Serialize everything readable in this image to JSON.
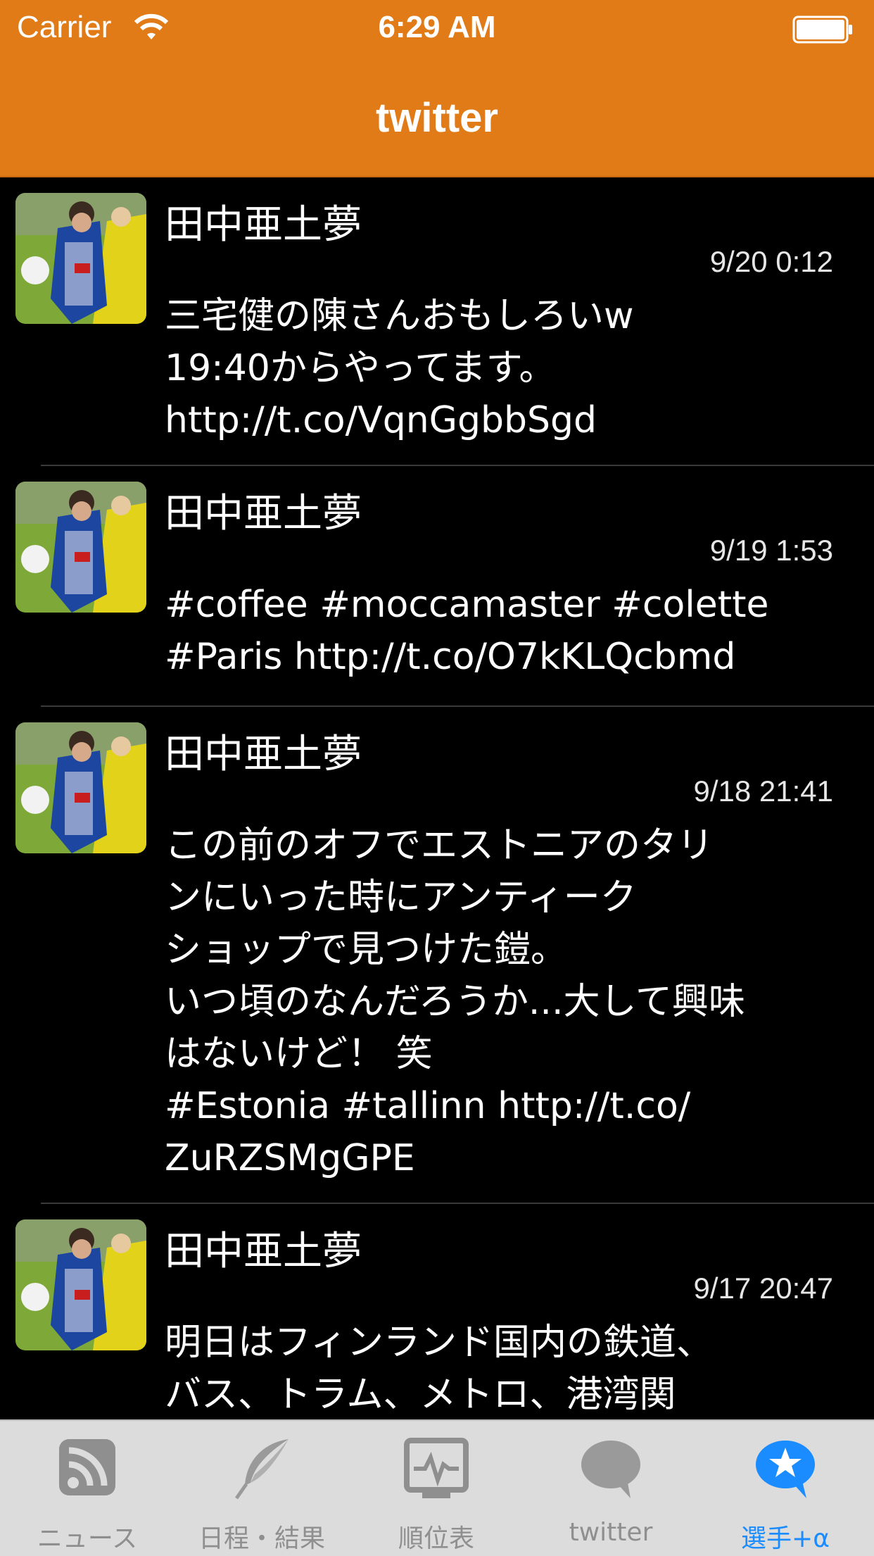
{
  "status_bar": {
    "carrier": "Carrier",
    "time": "6:29 AM"
  },
  "nav": {
    "title": "twitter"
  },
  "tweets": [
    {
      "name": "田中亜土夢",
      "time": "9/20 0:12",
      "text": "三宅健の陳さんおもしろいw\n19:40からやってます。\nhttp://t.co/VqnGgbbSgd"
    },
    {
      "name": "田中亜土夢",
      "time": "9/19 1:53",
      "text": "#coffee #moccamaster #colette\n#Paris http://t.co/O7kKLQcbmd"
    },
    {
      "name": "田中亜土夢",
      "time": "9/18 21:41",
      "text": "この前のオフでエストニアのタリ\nンにいった時にアンティーク\nショップで見つけた鎧。\nいつ頃のなんだろうか...大して興味\nはないけど！ 笑\n#Estonia #tallinn http://t.co/\nZuRZSMgGPE"
    },
    {
      "name": "田中亜土夢",
      "time": "9/17 20:47",
      "text": "明日はフィンランド国内の鉄道、\nバス、トラム、メトロ、港湾関"
    }
  ],
  "tab_bar": {
    "items": [
      {
        "label": "ニュース",
        "icon": "rss-icon",
        "active": false
      },
      {
        "label": "日程・結果",
        "icon": "feather-icon",
        "active": false
      },
      {
        "label": "順位表",
        "icon": "chart-pulse-icon",
        "active": false
      },
      {
        "label": "twitter",
        "icon": "speech-bubble-icon",
        "active": false
      },
      {
        "label": "選手+α",
        "icon": "star-bubble-icon",
        "active": true
      }
    ],
    "active_color": "#1a8cff",
    "inactive_color": "#8f8f8f"
  },
  "colors": {
    "accent": "#e07b17",
    "background": "#000000"
  }
}
